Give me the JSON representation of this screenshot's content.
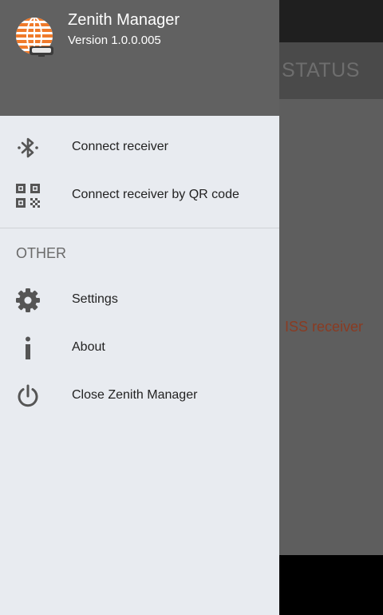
{
  "drawer": {
    "app_name": "Zenith Manager",
    "version": "Version 1.0.0.005",
    "items": [
      {
        "label": "Connect receiver",
        "icon": "bluetooth-icon"
      },
      {
        "label": "Connect receiver by QR code",
        "icon": "qr-code-icon"
      }
    ],
    "section_title": "OTHER",
    "other_items": [
      {
        "label": "Settings",
        "icon": "gear-icon"
      },
      {
        "label": "About",
        "icon": "info-icon"
      },
      {
        "label": "Close Zenith Manager",
        "icon": "power-icon"
      }
    ]
  },
  "background": {
    "tab_label": "STATUS",
    "message": "ISS receiver"
  },
  "colors": {
    "drawer_header": "#616161",
    "drawer_body": "#e8ebf0",
    "logo_orange": "#f07a2a",
    "message_text": "#8a3b22"
  }
}
